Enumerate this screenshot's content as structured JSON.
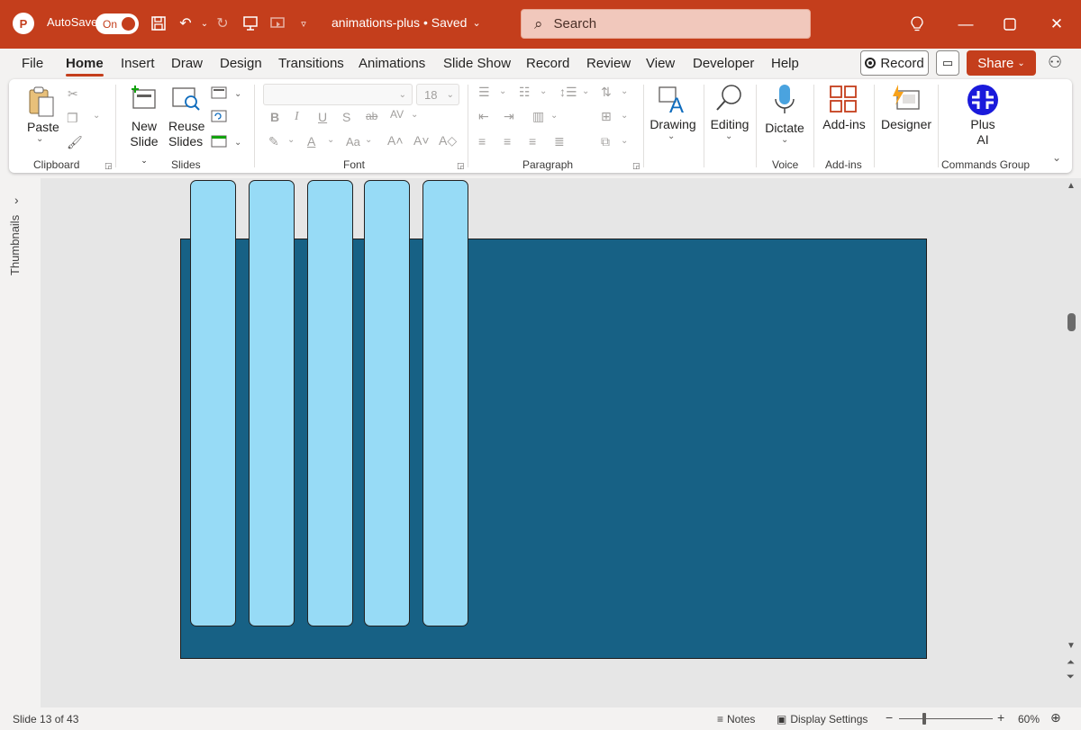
{
  "titlebar": {
    "autosave_label": "AutoSave",
    "autosave_state": "On",
    "document_title": "animations-plus • Saved",
    "search_placeholder": "Search"
  },
  "menu": {
    "tabs": [
      "File",
      "Home",
      "Insert",
      "Draw",
      "Design",
      "Transitions",
      "Animations",
      "Slide Show",
      "Record",
      "Review",
      "View",
      "Developer",
      "Help"
    ],
    "active_tab": "Home",
    "record_label": "Record",
    "share_label": "Share"
  },
  "ribbon": {
    "clipboard": {
      "paste_label": "Paste",
      "group_label": "Clipboard"
    },
    "slides": {
      "new_slide_line1": "New",
      "new_slide_line2": "Slide",
      "reuse_line1": "Reuse",
      "reuse_line2": "Slides",
      "group_label": "Slides"
    },
    "font": {
      "font_size": "18",
      "group_label": "Font"
    },
    "paragraph": {
      "group_label": "Paragraph"
    },
    "drawing": {
      "label": "Drawing"
    },
    "editing": {
      "label": "Editing"
    },
    "voice": {
      "dictate_label": "Dictate",
      "group_label": "Voice"
    },
    "addins": {
      "label": "Add-ins",
      "group_label": "Add-ins"
    },
    "designer": {
      "label": "Designer"
    },
    "plus_ai": {
      "line1": "Plus",
      "line2": "AI",
      "group_label": "Commands Group",
      "color": "#1a1adb"
    }
  },
  "thumbnails": {
    "label": "Thumbnails"
  },
  "slide": {
    "background": "#176185",
    "bar_color": "#97dbf6",
    "bar_count": 5
  },
  "status": {
    "slide_info": "Slide 13 of 43",
    "notes_label": "Notes",
    "display_settings_label": "Display Settings",
    "zoom_level": "60%"
  },
  "colors": {
    "accent": "#c43e1c"
  }
}
